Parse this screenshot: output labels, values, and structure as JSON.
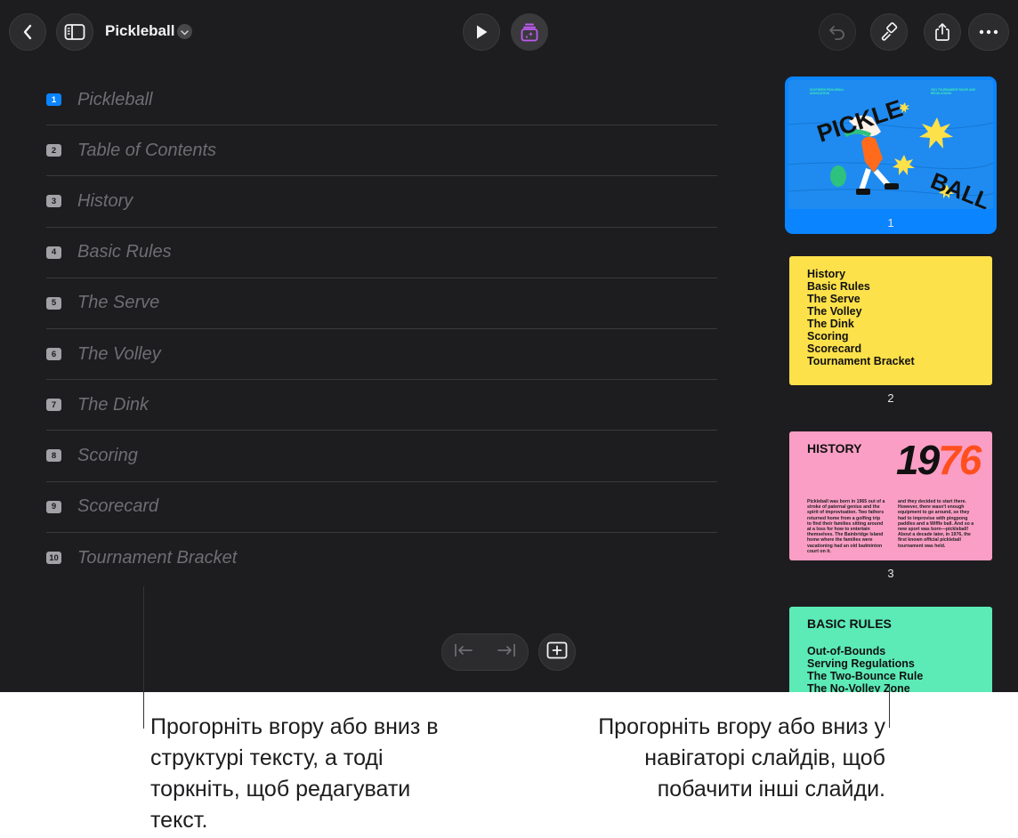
{
  "toolbar": {
    "title": "Pickleball",
    "icons": [
      "back-icon",
      "sidebar-icon",
      "chevron-down-icon",
      "play-icon",
      "animate-icon",
      "undo-icon",
      "paintbrush-icon",
      "share-icon",
      "more-icon"
    ]
  },
  "outline": {
    "items": [
      {
        "num": "1",
        "label": "Pickleball"
      },
      {
        "num": "2",
        "label": "Table of Contents"
      },
      {
        "num": "3",
        "label": "History"
      },
      {
        "num": "4",
        "label": "Basic Rules"
      },
      {
        "num": "5",
        "label": "The Serve"
      },
      {
        "num": "6",
        "label": "The Volley"
      },
      {
        "num": "7",
        "label": "The Dink"
      },
      {
        "num": "8",
        "label": "Scoring"
      },
      {
        "num": "9",
        "label": "Scorecard"
      },
      {
        "num": "10",
        "label": "Tournament Bracket"
      }
    ]
  },
  "navigator": {
    "slides": [
      {
        "number": "1",
        "word_top": "PICKLE",
        "word_bottom": "BALL",
        "header_left": "SOUTHERN PICKLEBALL ASSOCIATION",
        "header_right": "2021 TOURNAMENT RULES AND REGULATIONS"
      },
      {
        "number": "2",
        "lines": [
          "History",
          "Basic Rules",
          "The Serve",
          "The Volley",
          "The Dink",
          "Scoring",
          "Scorecard",
          "Tournament Bracket"
        ]
      },
      {
        "number": "3",
        "heading": "HISTORY",
        "year": "1976",
        "col1": "Pickleball was born in 1965 out of a stroke of paternal genius and the spirit of improvisation. Two fathers returned home from a golfing trip to find their families sitting around at a loss for how to entertain themselves. The Bainbridge Island home where the families were vacationing had an old badminton court on it.",
        "col2": "and they decided to start there. However, there wasn't enough equipment to go around, so they had to improvise with pingpong paddles and a Wiffle ball. And so a new sport was born—pickleball! About a decade later, in 1976, the first known official pickleball tournament was held."
      },
      {
        "number": "4",
        "heading": "BASIC RULES",
        "lines": [
          "Out-of-Bounds",
          "Serving Regulations",
          "The Two-Bounce Rule",
          "The No-Volley Zone"
        ]
      }
    ]
  },
  "callouts": {
    "left": "Прогорніть вгору або вниз в структурі тексту, а тоді торкніть, щоб редагувати текст.",
    "right": "Прогорніть вгору або вниз у навігаторі слайдів, щоб побачити інші слайди."
  },
  "colors": {
    "app_background": "#1d1d1f",
    "accent": "#0a84ff",
    "animate_accent": "#bf5af2",
    "slide1": "#1f8bf0",
    "slide2": "#fde14a",
    "slide3": "#fb9ec5",
    "slide4": "#5ceab7"
  }
}
